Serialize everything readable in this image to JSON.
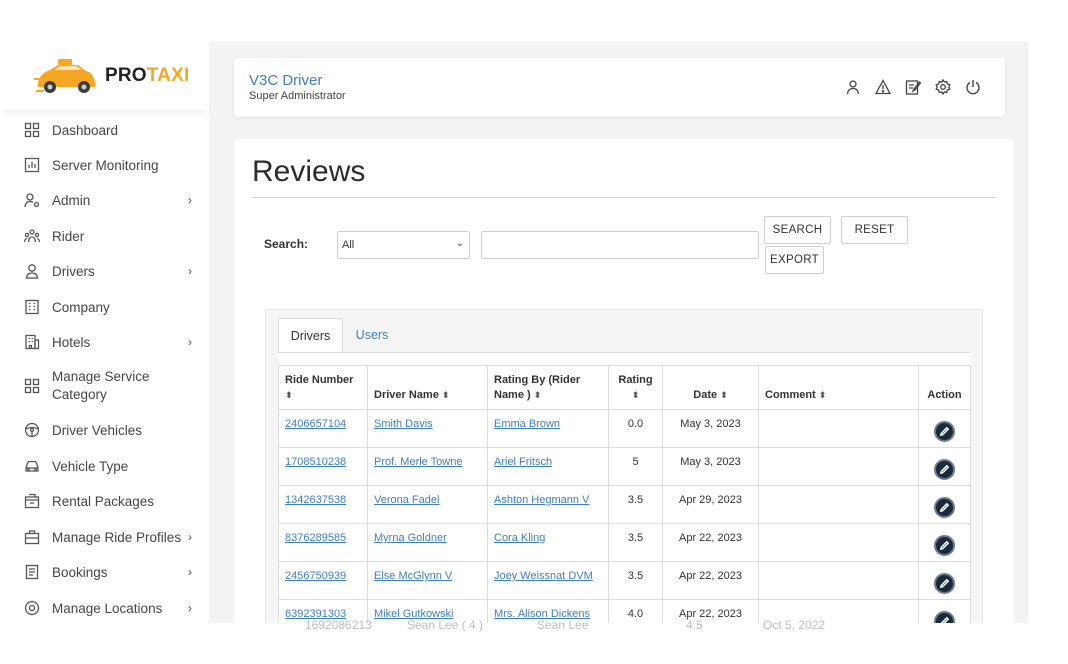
{
  "brand": {
    "name_part1": "PRO",
    "name_part2": "TAXI"
  },
  "sidebar": {
    "items": [
      {
        "label": "Dashboard",
        "icon": "dashboard-icon",
        "has_submenu": false
      },
      {
        "label": "Server Monitoring",
        "icon": "chart-icon",
        "has_submenu": false
      },
      {
        "label": "Admin",
        "icon": "user-gear-icon",
        "has_submenu": true
      },
      {
        "label": "Rider",
        "icon": "users-icon",
        "has_submenu": false
      },
      {
        "label": "Drivers",
        "icon": "driver-icon",
        "has_submenu": true
      },
      {
        "label": "Company",
        "icon": "building-icon",
        "has_submenu": false
      },
      {
        "label": "Hotels",
        "icon": "hotel-icon",
        "has_submenu": true
      },
      {
        "label": "Manage Service Category",
        "icon": "grid-icon",
        "has_submenu": false
      },
      {
        "label": "Driver Vehicles",
        "icon": "steering-wheel-icon",
        "has_submenu": false
      },
      {
        "label": "Vehicle Type",
        "icon": "car-icon",
        "has_submenu": false
      },
      {
        "label": "Rental Packages",
        "icon": "package-icon",
        "has_submenu": false
      },
      {
        "label": "Manage Ride Profiles",
        "icon": "briefcase-icon",
        "has_submenu": true
      },
      {
        "label": "Bookings",
        "icon": "bookings-icon",
        "has_submenu": true
      },
      {
        "label": "Manage Locations",
        "icon": "location-icon",
        "has_submenu": true
      }
    ]
  },
  "header": {
    "title": "V3C Driver",
    "subtitle": "Super Administrator",
    "icons": [
      "profile-icon",
      "warning-icon",
      "edit-document-icon",
      "settings-icon",
      "power-icon"
    ]
  },
  "page": {
    "title": "Reviews",
    "search_label": "Search:",
    "select_value": "All",
    "search_value": "",
    "buttons": {
      "search": "SEARCH",
      "reset": "RESET",
      "export": "EXPORT"
    }
  },
  "tabs": [
    {
      "label": "Drivers",
      "active": true
    },
    {
      "label": "Users",
      "active": false
    }
  ],
  "table": {
    "headers": [
      "Ride Number",
      "Driver Name",
      "Rating By (Rider Name )",
      "Rating",
      "Date",
      "Comment",
      "Action"
    ],
    "rows": [
      {
        "ride": "2406657104",
        "driver": "Smith Davis",
        "rider": "Emma Brown",
        "rating": "0.0",
        "date": "May 3, 2023",
        "comment": ""
      },
      {
        "ride": "1708510238",
        "driver": "Prof. Merle Towne",
        "rider": "Ariel Fritsch",
        "rating": "5",
        "date": "May 3, 2023",
        "comment": ""
      },
      {
        "ride": "1342637538",
        "driver": "Verona Fadel",
        "rider": "Ashton Hegmann V",
        "rating": "3.5",
        "date": "Apr 29, 2023",
        "comment": ""
      },
      {
        "ride": "8376289585",
        "driver": "Myrna Goldner",
        "rider": "Cora Kling",
        "rating": "3.5",
        "date": "Apr 22, 2023",
        "comment": ""
      },
      {
        "ride": "2456750939",
        "driver": "Else McGlynn V",
        "rider": "Joey Weissnat DVM",
        "rating": "3.5",
        "date": "Apr 22, 2023",
        "comment": ""
      },
      {
        "ride": "6392391303",
        "driver": "Mikel Gutkowski",
        "rider": "Mrs. Alison Dickens",
        "rating": "4.0",
        "date": "Apr 22, 2023",
        "comment": ""
      }
    ]
  },
  "ghost_row": {
    "ride": "1692086213",
    "driver": "Sean Lee ( 4 )",
    "rider": "Sean Lee",
    "rating": "4.5",
    "date": "Oct 5, 2022"
  },
  "colors": {
    "accent": "#3d7ec4",
    "brand_orange": "#f5a623",
    "edit_button": "#1a2a3c"
  }
}
